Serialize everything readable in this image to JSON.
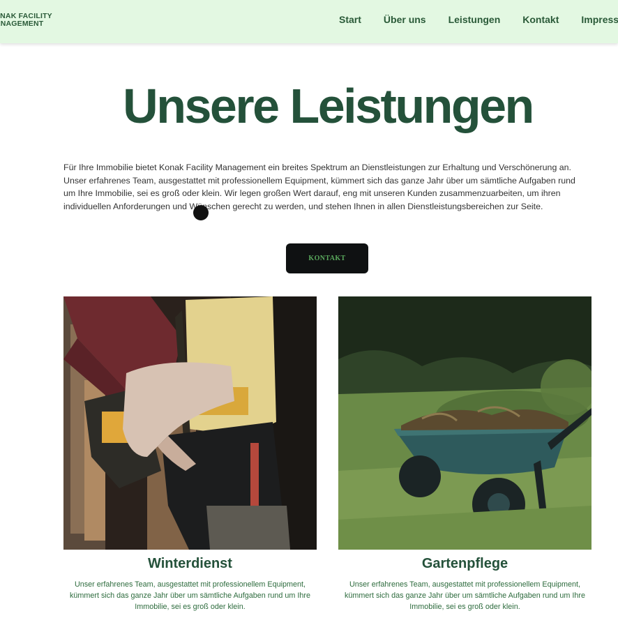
{
  "header": {
    "logo_line1": "KONAK FACILITY",
    "logo_line2": "MANAGEMENT",
    "nav": [
      "Start",
      "Über uns",
      "Leistungen",
      "Kontakt",
      "Impressum"
    ]
  },
  "hero": {
    "title": "Unsere Leistungen",
    "intro": "Für Ihre Immobilie bietet Konak Facility Management ein breites Spektrum an Dienstleistungen zur Erhaltung und Verschönerung an. Unser erfahrenes Team, ausgestattet mit professionellem Equipment, kümmert sich das ganze Jahr über um sämtliche Aufgaben rund um Ihre Immobilie, sei es groß oder klein. Wir legen großen Wert darauf, eng mit unseren Kunden zusammenzuarbeiten, um ihren individuellen Anforderungen und Wünschen gerecht zu werden, und stehen Ihnen in allen Dienstleistungsbereichen zur Seite.",
    "cta_label": "KONTAKT"
  },
  "services": [
    {
      "title": "Winterdienst",
      "text": "Unser erfahrenes Team, ausgestattet mit professionellem Equipment, kümmert sich das ganze Jahr über um sämtliche Aufgaben rund um Ihre Immobilie, sei es groß oder klein.",
      "image_icon": "tool-belt-photo"
    },
    {
      "title": "Gartenpflege",
      "text": "Unser erfahrenes Team, ausgestattet mit professionellem Equipment, kümmert sich das ganze Jahr über um sämtliche Aufgaben rund um Ihre Immobilie, sei es groß oder klein.",
      "image_icon": "wheelbarrow-photo"
    }
  ],
  "colors": {
    "header_bg": "#e3f8e2",
    "brand_green": "#24513a",
    "accent_green": "#5aa95d",
    "button_bg": "#0f1112"
  }
}
